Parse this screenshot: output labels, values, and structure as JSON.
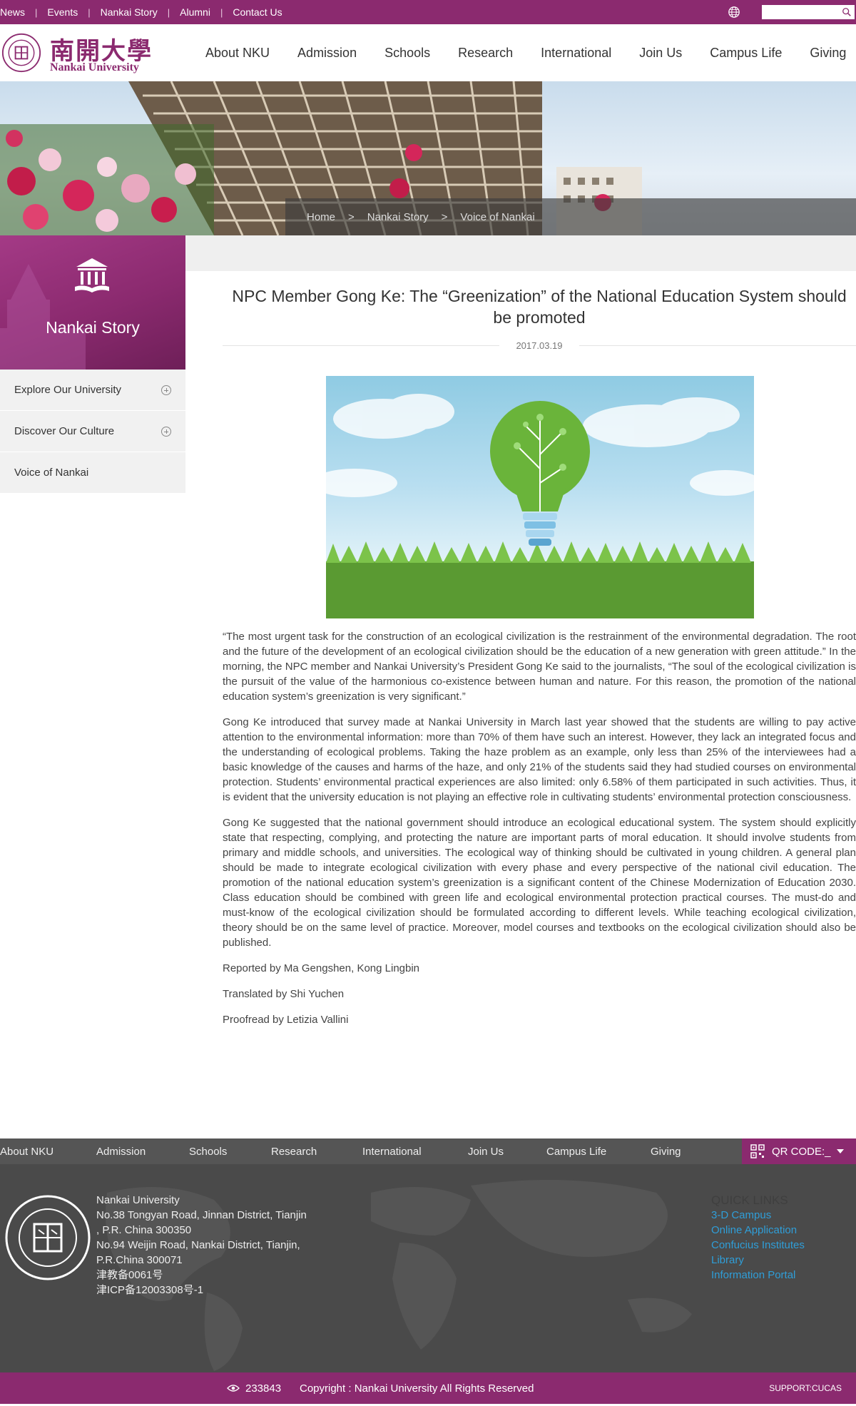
{
  "topbar": {
    "links": [
      "News",
      "Events",
      "Nankai Story",
      "Alumni",
      "Contact Us"
    ],
    "search_placeholder": ""
  },
  "logo": {
    "cn": "南開大學",
    "en": "Nankai University"
  },
  "nav": [
    "About NKU",
    "Admission",
    "Schools",
    "Research",
    "International",
    "Join Us",
    "Campus Life",
    "Giving"
  ],
  "breadcrumb": [
    "Home",
    "Nankai Story",
    "Voice of Nankai"
  ],
  "breadcrumb_sep": ">",
  "sidebar": {
    "title": "Nankai Story",
    "items": [
      {
        "label": "Explore Our University",
        "expandable": true
      },
      {
        "label": "Discover Our Culture",
        "expandable": true
      },
      {
        "label": "Voice of Nankai",
        "expandable": false
      }
    ]
  },
  "article": {
    "title": "NPC Member Gong Ke: The “Greenization” of the National Education System should be promoted",
    "date": "2017.03.19",
    "paragraphs": [
      "“The most urgent task for the construction of an ecological civilization is the restrainment of the environmental degradation. The root and the future of the development of an ecological civilization should be the education of a new generation with green attitude.” In the morning, the NPC member and Nankai University’s President Gong Ke said to the journalists, “The soul of the ecological civilization is the pursuit of the value of the harmonious co-existence between human and nature. For this reason, the promotion of the national education system’s greenization is very significant.”",
      "Gong Ke introduced that survey made at Nankai University in March last year  showed that the students are willing to pay active attention to the environmental information: more than 70% of them have such an interest. However, they lack an integrated focus and the understanding of ecological problems. Taking the haze problem as an example, only less than 25% of the interviewees had a basic knowledge of the causes and harms of the haze, and only 21% of the students said they had studied courses on environmental protection. Students’ environmental practical experiences are also limited: only 6.58% of them participated in such activities. Thus, it is evident that the university education is not playing an effective role in cultivating students’ environmental protection consciousness.",
      "Gong Ke suggested that the national government should introduce an ecological educational system. The system should explicitly state that respecting, complying, and protecting the nature are important parts of moral education. It should involve students from primary and middle schools, and universities. The ecological way of thinking should be cultivated in young children. A general plan should be made to integrate ecological civilization with every phase and every perspective of the national civil education. The promotion of the national education system’s greenization is a significant content of the Chinese Modernization of Education 2030. Class education should be combined with green life and ecological environmental protection practical courses. The must-do and must-know of the ecological civilization should be formulated according to different levels. While teaching ecological civilization, theory should be on the same level of practice. Moreover, model courses and textbooks on the ecological civilization should also be published.",
      "Reported by Ma Gengshen, Kong Lingbin",
      "Translated by Shi Yuchen",
      "Proofread by Letizia Vallini"
    ]
  },
  "footer": {
    "nav": [
      "About NKU",
      "Admission",
      "Schools",
      "Research",
      "International",
      "Join Us",
      "Campus Life",
      "Giving"
    ],
    "qr_label": "QR CODE:_",
    "address_lines": [
      "Nankai University",
      "No.38 Tongyan Road, Jinnan District, Tianjin",
      ", P.R. China 300350",
      "No.94 Weijin Road,  Nankai District, Tianjin,",
      "P.R.China  300071",
      "津教备0061号",
      "津ICP备12003308号-1"
    ],
    "quick_title": "QUICK LINKS",
    "quick_links": [
      "3-D Campus",
      "Online Application",
      "Confucius Institutes",
      "Library",
      "Information Portal"
    ],
    "visits": "233843",
    "copyright": "Copyright : Nankai University All Rights Reserved",
    "support": "SUPPORT:CUCAS"
  },
  "colors": {
    "brand": "#8b2a6f",
    "footer_dark": "#4a4a4a",
    "link_blue": "#2f9ed8"
  }
}
